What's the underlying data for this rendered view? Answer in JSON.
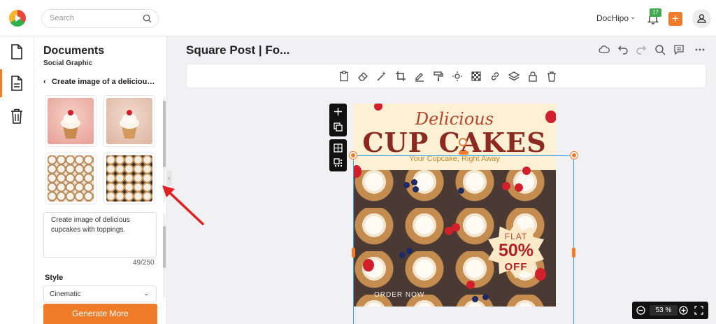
{
  "header": {
    "search_placeholder": "Search",
    "brand": "DocHipo",
    "notifications_count": "17",
    "add_label": "+"
  },
  "sidebar": {
    "title": "Documents",
    "subtitle": "Social Graphic",
    "back_label": "Create image of a delicious cupcakes",
    "prompt_text": "Create image of delicious cupcakes with toppings.",
    "counter": "49/250",
    "style_label": "Style",
    "style_value": "Cinematic",
    "generate_label": "Generate More"
  },
  "workspace": {
    "doc_title": "Square Post | Fo...",
    "zoom_level": "53",
    "zoom_unit": "%"
  },
  "canvas": {
    "script_text": "Delicious",
    "headline": "CUP CAKES",
    "tagline": "Your Cupcake, Right Away",
    "badge_flat": "FLAT",
    "badge_percent": "50%",
    "badge_off": "OFF",
    "cta": "ORDER NOW"
  },
  "colors": {
    "accent": "#f07c2a",
    "selection": "#36a3f0",
    "badge_green": "#3fab4c"
  }
}
